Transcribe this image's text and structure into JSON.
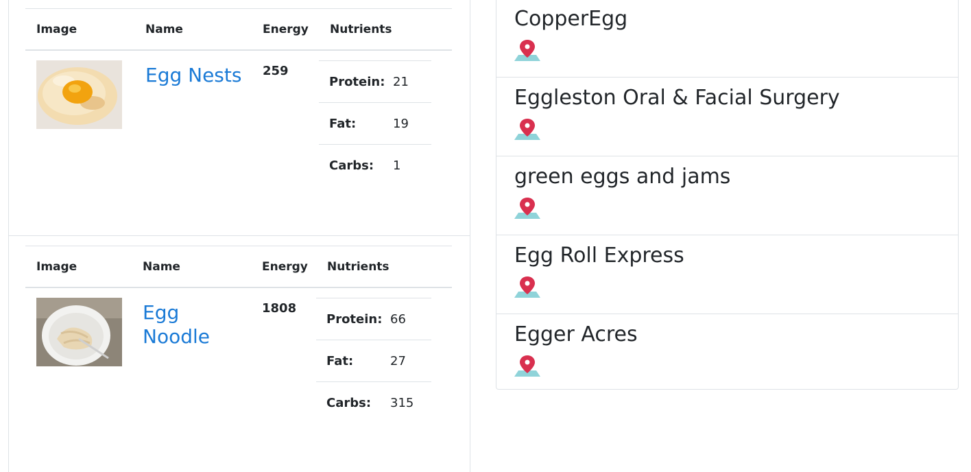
{
  "recipes": [
    {
      "headers": {
        "image": "Image",
        "name": "Name",
        "energy": "Energy",
        "nutrients": "Nutrients"
      },
      "name": "Egg Nests",
      "energy": "259",
      "nutrients": [
        {
          "label": "Protein:",
          "value": "21"
        },
        {
          "label": "Fat:",
          "value": "19"
        },
        {
          "label": "Carbs:",
          "value": "1"
        }
      ]
    },
    {
      "headers": {
        "image": "Image",
        "name": "Name",
        "energy": "Energy",
        "nutrients": "Nutrients"
      },
      "name": "Egg Noodle",
      "energy": "1808",
      "nutrients": [
        {
          "label": "Protein:",
          "value": "66"
        },
        {
          "label": "Fat:",
          "value": "27"
        },
        {
          "label": "Carbs:",
          "value": "315"
        }
      ]
    }
  ],
  "places": [
    {
      "name": "CopperEgg"
    },
    {
      "name": "Eggleston Oral & Facial Surgery"
    },
    {
      "name": "green eggs and jams"
    },
    {
      "name": "Egg Roll Express"
    },
    {
      "name": "Egger Acres"
    }
  ],
  "icons": {
    "map_pin": "map-pin-icon"
  },
  "colors": {
    "link": "#1a7ad6",
    "pin_red": "#d9304f",
    "map_teal": "#8fd3d9"
  }
}
